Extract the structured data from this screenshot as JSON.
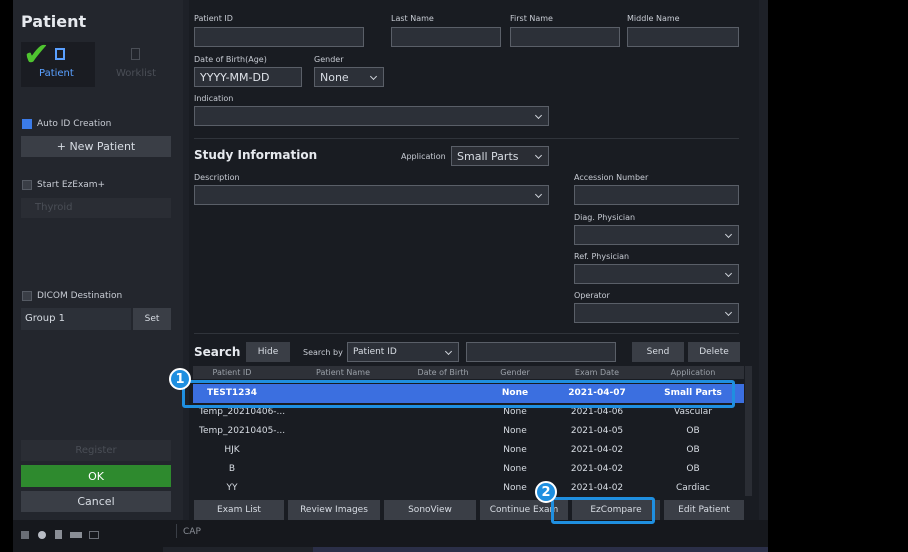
{
  "sidebar": {
    "title": "Patient",
    "tab_patient": "Patient",
    "tab_worklist": "Worklist",
    "auto_id": "Auto ID Creation",
    "new_patient": "+ New Patient",
    "start_ezexam": "Start EzExam+",
    "thyroid": "Thyroid",
    "dicom": "DICOM Destination",
    "group": "Group 1",
    "set": "Set",
    "register": "Register",
    "ok": "OK",
    "cancel": "Cancel"
  },
  "patient": {
    "id_label": "Patient ID",
    "last_label": "Last Name",
    "first_label": "First Name",
    "middle_label": "Middle Name",
    "dob_label": "Date of Birth(Age)",
    "dob_value": "YYYY-MM-DD",
    "gender_label": "Gender",
    "gender_value": "None",
    "indication_label": "Indication"
  },
  "study": {
    "title": "Study Information",
    "application_label": "Application",
    "application_value": "Small Parts",
    "description_label": "Description",
    "accession_label": "Accession Number",
    "diag_label": "Diag. Physician",
    "ref_label": "Ref. Physician",
    "operator_label": "Operator"
  },
  "search": {
    "title": "Search",
    "hide": "Hide",
    "search_by": "Search by",
    "search_by_value": "Patient ID",
    "send": "Send",
    "delete": "Delete"
  },
  "table": {
    "headers": [
      "Patient ID",
      "Patient Name",
      "Date of Birth",
      "Gender",
      "Exam Date",
      "Application"
    ],
    "rows": [
      [
        "TEST1234",
        "",
        "",
        "None",
        "2021-04-07",
        "Small Parts"
      ],
      [
        "Temp_20210406-...",
        "",
        "",
        "None",
        "2021-04-06",
        "Vascular"
      ],
      [
        "Temp_20210405-...",
        "",
        "",
        "None",
        "2021-04-05",
        "OB"
      ],
      [
        "HJK",
        "",
        "",
        "None",
        "2021-04-02",
        "OB"
      ],
      [
        "B",
        "",
        "",
        "None",
        "2021-04-02",
        "OB"
      ],
      [
        "YY",
        "",
        "",
        "None",
        "2021-04-02",
        "Cardiac"
      ]
    ]
  },
  "actions": {
    "exam_list": "Exam List",
    "review": "Review Images",
    "sonoview": "SonoView",
    "continue": "Continue Exam",
    "ezcompare": "EzCompare",
    "edit": "Edit Patient"
  },
  "status": {
    "cap": "CAP"
  },
  "badges": {
    "one": "1",
    "two": "2"
  },
  "colors": {
    "accent": "#1f8fe0",
    "selected_row": "#3b6fe0",
    "ok_green": "#2e8a2e"
  }
}
